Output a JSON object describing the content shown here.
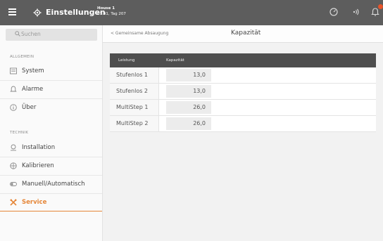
{
  "header": {
    "app_title": "Einstellungen",
    "house_name": "House 1",
    "time_day": "07:41, Tag 207"
  },
  "sidebar": {
    "search_placeholder": "Suchen",
    "section_general": "ALLGEMEIN",
    "section_technik": "TECHNIK",
    "items": [
      {
        "label": "System",
        "icon": "system-icon"
      },
      {
        "label": "Alarme",
        "icon": "alarm-icon"
      },
      {
        "label": "Über",
        "icon": "info-icon"
      },
      {
        "label": "Installation",
        "icon": "installation-icon"
      },
      {
        "label": "Kalibrieren",
        "icon": "calibrate-icon"
      },
      {
        "label": "Manuell/Automatisch",
        "icon": "toggle-icon"
      },
      {
        "label": "Service",
        "icon": "service-icon",
        "active": true
      }
    ]
  },
  "subheader": {
    "back_label": "< Gemeinsame Absaugung",
    "title": "Kapazität"
  },
  "table": {
    "columns": [
      "Leistung",
      "Kapazität"
    ],
    "rows": [
      {
        "name": "Stufenlos 1",
        "value": "13,0"
      },
      {
        "name": "Stufenlos 2",
        "value": "13,0"
      },
      {
        "name": "MultiStep 1",
        "value": "26,0"
      },
      {
        "name": "MultiStep 2",
        "value": "26,0"
      }
    ]
  },
  "colors": {
    "topbar": "#5d5d5d",
    "accent": "#e58638",
    "badge": "#e8542a",
    "table_header": "#4e4e4e"
  }
}
